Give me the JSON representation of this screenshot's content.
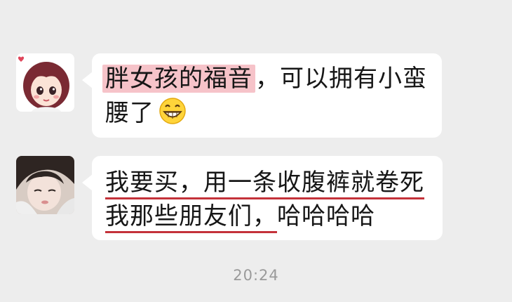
{
  "messages": [
    {
      "sender_avatar": "cartoon-girl-avatar",
      "line1_highlight": "胖女孩的福音",
      "line1_rest": "，可以拥有小蛮",
      "line2": "腰了",
      "emoji": "grinning-face-emoji"
    },
    {
      "sender_avatar": "photo-avatar",
      "line1": "我要买，用一条收腹裤就卷死",
      "line2_underlined": "我那些朋友们，",
      "line2_rest": "哈哈哈哈"
    }
  ],
  "timestamp": "20:24",
  "colors": {
    "background": "#ededed",
    "bubble": "#ffffff",
    "highlight": "#f6c3c9",
    "underline": "#c4323a"
  }
}
